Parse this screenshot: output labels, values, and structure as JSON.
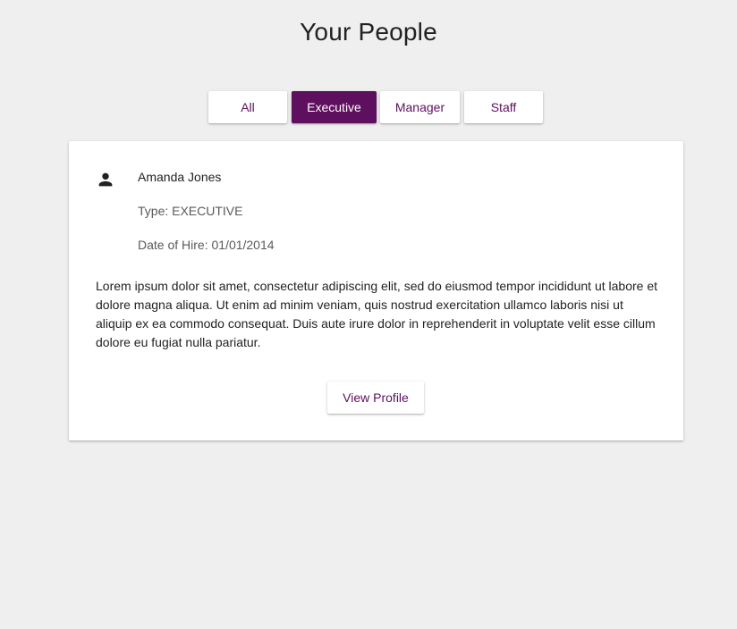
{
  "page": {
    "title": "Your People"
  },
  "filters": {
    "tabs": [
      {
        "label": "All"
      },
      {
        "label": "Executive"
      },
      {
        "label": "Manager"
      },
      {
        "label": "Staff"
      }
    ],
    "selected": "Executive"
  },
  "person": {
    "icon": "person-icon",
    "name": "Amanda Jones",
    "type_line": "Type: EXECUTIVE",
    "hire_line": "Date of Hire: 01/01/2014",
    "bio": "Lorem ipsum dolor sit amet, consectetur adipiscing elit, sed do eiusmod tempor incididunt ut labore et dolore magna aliqua. Ut enim ad minim veniam, quis nostrud exercitation ullamco laboris nisi ut aliquip ex ea commodo consequat. Duis aute irure dolor in reprehenderit in voluptate velit esse cillum dolore eu fugiat nulla pariatur.",
    "view_profile_label": "View Profile"
  },
  "colors": {
    "accent": "#5e0f5e",
    "background": "#efefef",
    "card": "#ffffff",
    "text": "#222222",
    "secondary_text": "#5a5a5a"
  }
}
